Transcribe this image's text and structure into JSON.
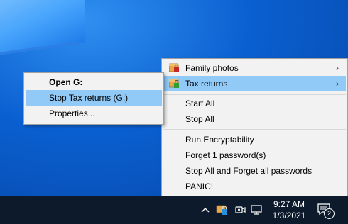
{
  "main_menu": {
    "items": [
      {
        "label": "Family photos",
        "has_submenu": true,
        "icon": "lock-icon-red"
      },
      {
        "label": "Tax returns",
        "has_submenu": true,
        "icon": "lock-icon-green",
        "highlighted": true
      },
      {
        "label": "Start All"
      },
      {
        "label": "Stop All"
      },
      {
        "label": "Run Encryptability"
      },
      {
        "label": "Forget 1 password(s)"
      },
      {
        "label": "Stop All and Forget all passwords"
      },
      {
        "label": "PANIC!"
      }
    ],
    "arrow": "›"
  },
  "sub_menu": {
    "items": [
      {
        "label": "Open G:",
        "bold": true
      },
      {
        "label": "Stop Tax returns (G:)",
        "highlighted": true
      },
      {
        "label": "Properties..."
      }
    ]
  },
  "taskbar": {
    "time": "9:27 AM",
    "date": "1/3/2021",
    "notification_count": "2",
    "tray_icons": [
      "chevron-up-icon",
      "encryptability-tray-icon",
      "meet-now-icon",
      "network-icon"
    ]
  },
  "colors": {
    "menu_bg": "#f2f2f2",
    "highlight": "#91c9f7",
    "taskbar": "#0c1a2b",
    "desktop": "#0a5fd0"
  }
}
